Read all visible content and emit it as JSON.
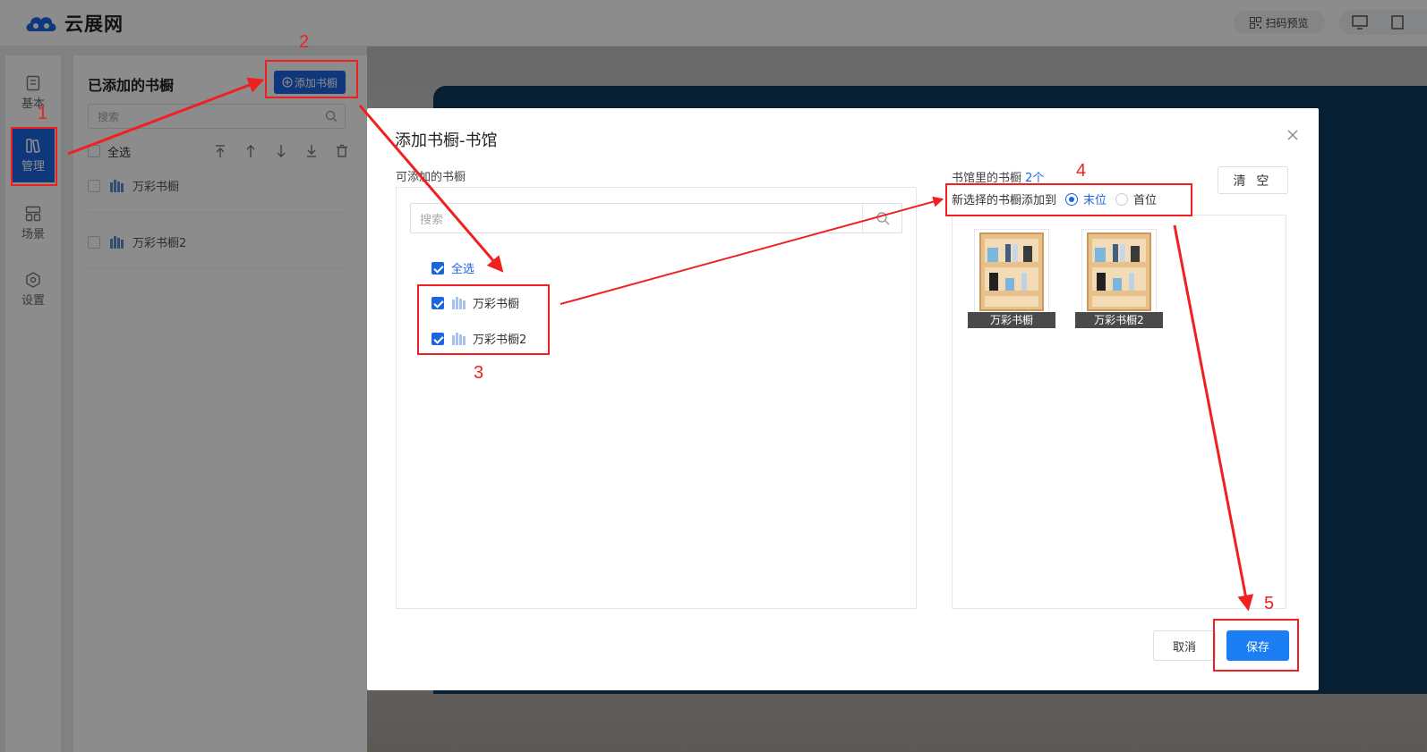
{
  "app": {
    "logo_text": "云展网"
  },
  "topbar": {
    "scan_preview": "扫码预览"
  },
  "nav": {
    "items": [
      {
        "label": "基本",
        "icon": "document-icon"
      },
      {
        "label": "管理",
        "icon": "bookshelf-icon",
        "active": true
      },
      {
        "label": "场景",
        "icon": "layout-icon"
      },
      {
        "label": "设置",
        "icon": "gear-icon"
      }
    ]
  },
  "panel": {
    "title": "已添加的书橱",
    "add_button": "添加书橱",
    "search_placeholder": "搜索",
    "select_all": "全选",
    "items": [
      "万彩书橱",
      "万彩书橱2"
    ]
  },
  "modal": {
    "title": "添加书橱-书馆",
    "available_label": "可添加的书橱",
    "search_placeholder": "搜索",
    "select_all": "全选",
    "items": [
      "万彩书橱",
      "万彩书橱2"
    ],
    "library_label": "书馆里的书橱",
    "library_count": "2个",
    "clear_button": "清 空",
    "position_label": "新选择的书橱添加到",
    "position_options": [
      "末位",
      "首位"
    ],
    "selected_position": "末位",
    "shelves": [
      "万彩书橱",
      "万彩书橱2"
    ],
    "cancel_button": "取消",
    "save_button": "保存"
  },
  "annotations": {
    "numbers": [
      "1",
      "2",
      "3",
      "4",
      "5"
    ]
  },
  "colors": {
    "primary": "#1b66e0",
    "save": "#1b7ef5",
    "annotation": "#f02020"
  }
}
